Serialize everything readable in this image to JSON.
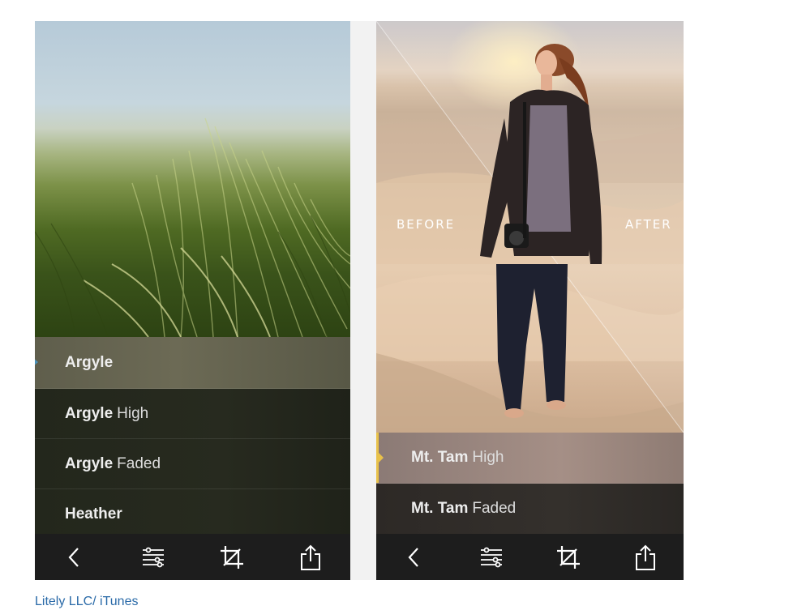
{
  "left_screen": {
    "filters": [
      {
        "name": "Argyle",
        "variant": ""
      },
      {
        "name": "Argyle",
        "variant": "High"
      },
      {
        "name": "Argyle",
        "variant": "Faded"
      },
      {
        "name": "Heather",
        "variant": ""
      }
    ],
    "selected_index": 0
  },
  "right_screen": {
    "before_label": "BEFORE",
    "after_label": "AFTER",
    "filters": [
      {
        "name": "Mt. Tam",
        "variant": "High"
      },
      {
        "name": "Mt. Tam",
        "variant": "Faded"
      }
    ],
    "selected_index": 0
  },
  "toolbar": {
    "icons": [
      "back-icon",
      "adjust-sliders-icon",
      "crop-icon",
      "share-icon"
    ]
  },
  "caption": "Litely LLC/ iTunes",
  "colors": {
    "selected_marker_left": "#4a90b8",
    "selected_marker_right": "#e8c14a",
    "caption_link": "#2a6aa8"
  }
}
